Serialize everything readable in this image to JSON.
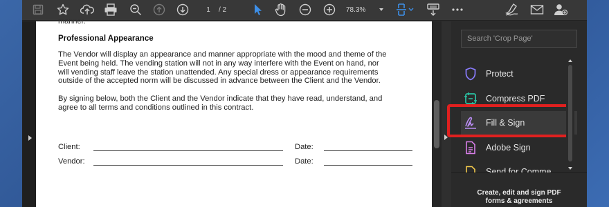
{
  "toolbar": {
    "page_current": "1",
    "page_total": "/  2",
    "zoom_value": "78.3%"
  },
  "document": {
    "cut_text": "manner.",
    "heading": "Professional Appearance",
    "para1": [
      "The Vendor will display an appearance and manner appropriate with the mood and theme of the",
      "Event being held. The vending station will not in any way interfere with the Event on hand, nor",
      "will vending staff leave the station unattended. Any special dress or appearance requirements",
      "outside of the accepted norm will be discussed in advance between the Client and the Vendor."
    ],
    "para2": [
      "By signing below, both the Client and the Vendor indicate that they have read, understand, and",
      "agree to all terms and conditions outlined in this contract."
    ],
    "client_label": "Client:",
    "vendor_label": "Vendor:",
    "date_label": "Date:"
  },
  "right_pane": {
    "search_placeholder": "Search 'Crop Page'",
    "tools": [
      {
        "label": "Protect",
        "icon": "shield-icon",
        "color": "#8a7cff"
      },
      {
        "label": "Compress PDF",
        "icon": "compress-pdf-icon",
        "color": "#2bc4a4"
      },
      {
        "label": "Fill & Sign",
        "icon": "fill-sign-icon",
        "color": "#b98cf2"
      },
      {
        "label": "Adobe Sign",
        "icon": "adobe-sign-icon",
        "color": "#d77ee8"
      },
      {
        "label": "Send for Comme",
        "icon": "send-for-comment-icon",
        "color": "#f2c94c"
      }
    ],
    "footer_line1": "Create, edit and sign PDF",
    "footer_line2": "forms & agreements"
  },
  "colors": {
    "highlight_box": "#e0201f",
    "select_tool_blue": "#3d8fe8"
  }
}
